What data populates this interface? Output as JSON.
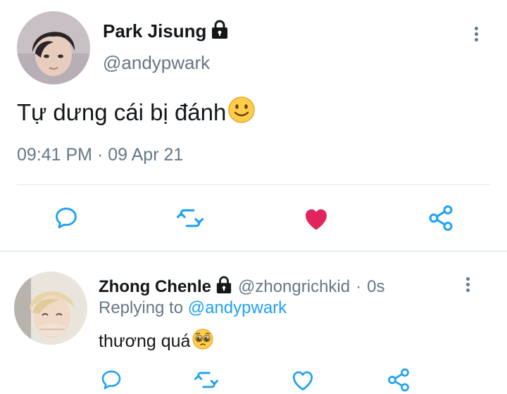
{
  "tweet": {
    "author": {
      "display_name": "Park Jisung",
      "handle": "@andypwark",
      "protected": true
    },
    "text": "Tự dưng cái bị đánh",
    "emoji": "slightly-smiling-face",
    "timestamp": "09:41 PM",
    "separator": "·",
    "date": "09 Apr 21",
    "liked": true,
    "like_color": "#e0245e",
    "actions": [
      "reply",
      "retweet",
      "like",
      "share"
    ]
  },
  "reply": {
    "author": {
      "display_name": "Zhong Chenle",
      "handle": "@zhongrichkid",
      "protected": true
    },
    "separator": "·",
    "time_ago": "0s",
    "replying_label": "Replying to",
    "replying_to": "@andypwark",
    "text": "thương quá",
    "emoji": "pleading-face",
    "liked": false,
    "actions": [
      "reply",
      "retweet",
      "like",
      "share"
    ]
  },
  "colors": {
    "link": "#1da1f2",
    "secondary_text": "#657786",
    "icon": "#1da1f2",
    "divider": "#e1e8ed"
  }
}
